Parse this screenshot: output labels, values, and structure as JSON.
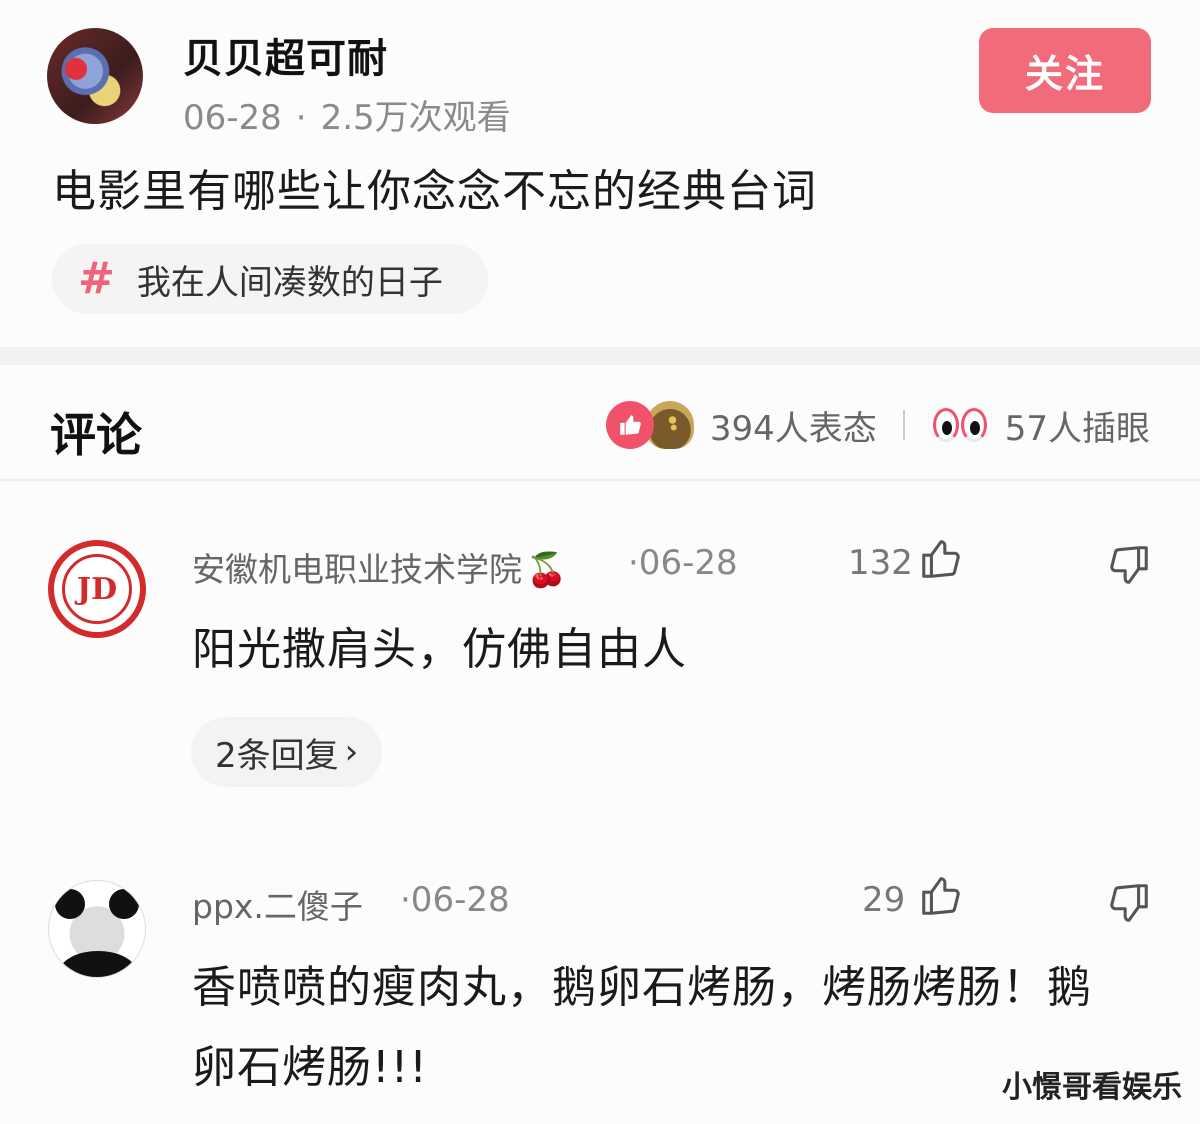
{
  "post": {
    "author": "贝贝超可耐",
    "date": "06-28",
    "separator": "·",
    "views": "2.5万次观看",
    "follow_label": "关注",
    "title": "电影里有哪些让你念念不忘的经典台词",
    "topic_hash": "#",
    "topic": "我在人间凑数的日子"
  },
  "comments_header": {
    "title": "评论",
    "reactions_count": "394人表态",
    "eyes_count": "57人插眼"
  },
  "comments": [
    {
      "author": "安徽机电职业技术学院",
      "badge": "🍒",
      "date": "·06-28",
      "likes": "132",
      "text": "阳光撒肩头，仿佛自由人",
      "replies": "2条回复",
      "replies_chevron": "›",
      "avatar_text": "JD"
    },
    {
      "author": "ppx.二傻子",
      "date": "·06-28",
      "likes": "29",
      "text_line1": "香喷喷的瘦肉丸，鹅卵石烤肠，烤肠烤肠！鹅",
      "text_line2": "卵石烤肠!!!"
    }
  ],
  "watermark": "小憬哥看娱乐",
  "colors": {
    "accent": "#f26b7a",
    "hash": "#f1637c",
    "like_bg": "#f0526a"
  }
}
